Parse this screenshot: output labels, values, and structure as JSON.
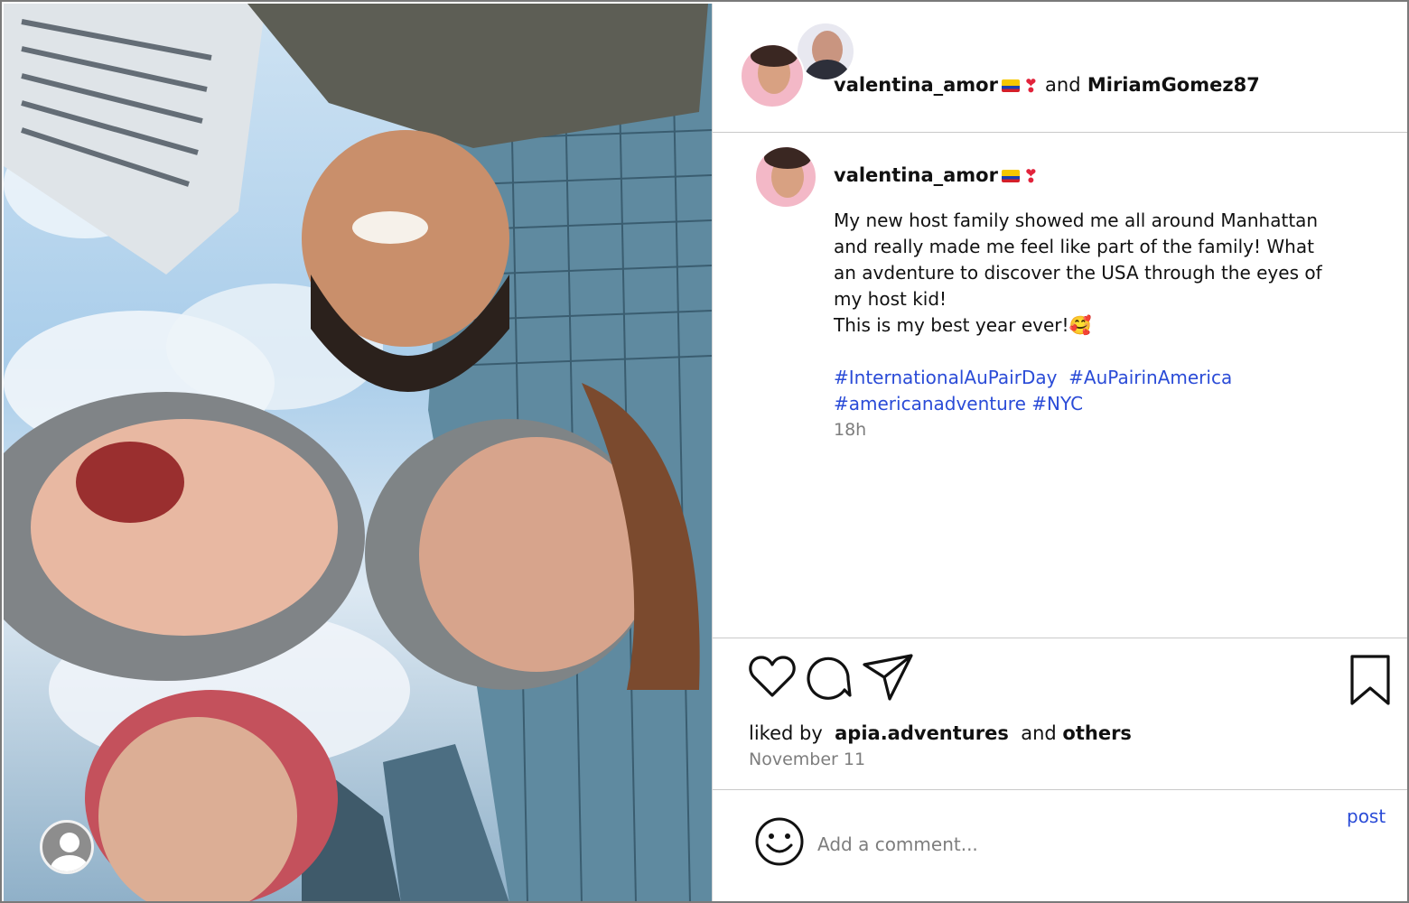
{
  "header": {
    "user1": "valentina_amor",
    "joiner": "and",
    "user2": "MiriamGomez87"
  },
  "post": {
    "username": "valentina_amor",
    "caption_lines": [
      "My new host family showed me all around Manhattan",
      "and really made me feel like part of the family! What",
      "an avdenture to discover the USA through the eyes of",
      "my host kid!",
      "This is my best year ever!🥰"
    ],
    "hashtags_line1": [
      "#InternationalAuPairDay",
      "#AuPairinAmerica"
    ],
    "hashtags_line2": [
      "#americanadventure",
      "#NYC"
    ],
    "time_ago": "18h"
  },
  "likes": {
    "prefix": "liked by",
    "user": "apia.adventures",
    "joiner": "and",
    "others": "others"
  },
  "date": "November 11",
  "comment": {
    "placeholder": "Add a comment...",
    "post_label": "post"
  },
  "colors": {
    "link_blue": "#2a4bd7",
    "muted_gray": "#7d7d7d",
    "flag_colombia": [
      "#f6c700",
      "#1a3fb0",
      "#d41f2a"
    ],
    "heart_exclamation": "#e2233b"
  },
  "icons": [
    "heart-icon",
    "comment-icon",
    "share-icon",
    "bookmark-icon",
    "smiley-icon",
    "profile-placeholder-icon",
    "colombia-flag-icon",
    "heart-exclamation-icon"
  ]
}
